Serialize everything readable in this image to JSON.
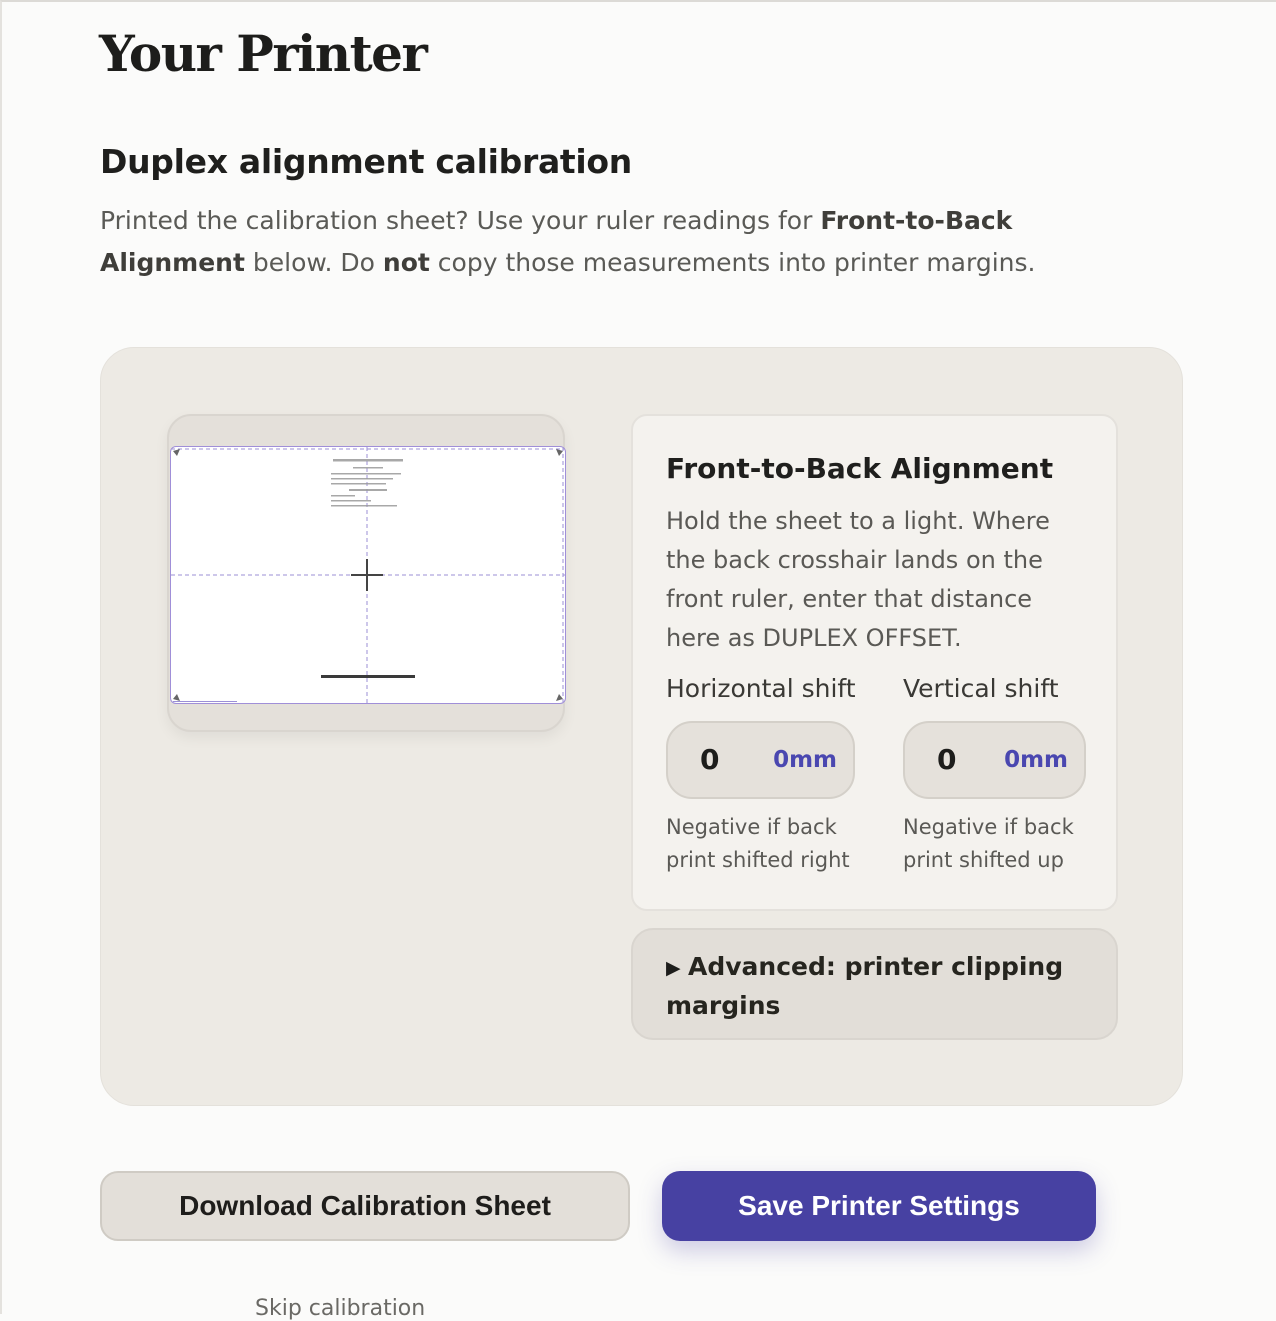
{
  "page": {
    "title": "Your Printer"
  },
  "calibration": {
    "title": "Duplex alignment calibration",
    "intro": {
      "part1": "Printed the calibration sheet? Use your ruler readings for ",
      "bold1": "Front-to-Back Alignment",
      "part2": " below. Do ",
      "bold2": "not",
      "part3": " copy those measurements into printer margins."
    }
  },
  "alignment": {
    "title": "Front-to-Back Alignment",
    "description": "Hold the sheet to a light. Where the back crosshair lands on the front ruler, enter that distance here as DUPLEX OFFSET.",
    "horizontal": {
      "label": "Horizontal shift",
      "value": "0",
      "unit": "0mm",
      "hint": "Negative if back print shifted right"
    },
    "vertical": {
      "label": "Vertical shift",
      "value": "0",
      "unit": "0mm",
      "hint": "Negative if back print shifted up"
    }
  },
  "advanced": {
    "label": "Advanced: printer clipping margins"
  },
  "actions": {
    "download": "Download Calibration Sheet",
    "save": "Save Printer Settings",
    "skip": "Skip calibration"
  },
  "colors": {
    "accent": "#4741a2",
    "panel": "#edeae4",
    "guide": "#9b8fd6"
  }
}
